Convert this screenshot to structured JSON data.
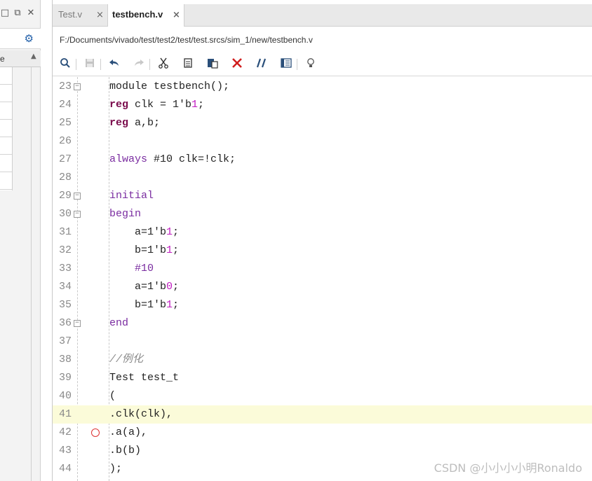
{
  "left_panel": {
    "icons": [
      "restore-icon",
      "undock-icon",
      "close-icon",
      "gear-icon"
    ],
    "column_header": "e",
    "sort_icon": "sort-up-icon"
  },
  "tabs": [
    {
      "label": "Test.v",
      "active": false,
      "close": "×"
    },
    {
      "label": "testbench.v",
      "active": true,
      "close": "×"
    }
  ],
  "path": "F:/Documents/vivado/test/test2/test/test.srcs/sim_1/new/testbench.v",
  "toolbar": [
    "search-icon",
    "save-icon",
    "undo-icon",
    "redo-icon",
    "cut-icon",
    "copy-icon",
    "paste-icon",
    "delete-icon",
    "comment-icon",
    "columns-icon",
    "lightbulb-icon"
  ],
  "code_lines": [
    {
      "n": "23",
      "fold": "−",
      "text": [
        {
          "t": "module testbench();",
          "c": ""
        }
      ]
    },
    {
      "n": "24",
      "text": [
        {
          "t": "reg",
          "c": "kw"
        },
        {
          "t": " clk = 1'b",
          "c": ""
        },
        {
          "t": "1",
          "c": "num"
        },
        {
          "t": ";",
          "c": ""
        }
      ]
    },
    {
      "n": "25",
      "text": [
        {
          "t": "reg",
          "c": "kw"
        },
        {
          "t": " a,b;",
          "c": ""
        }
      ]
    },
    {
      "n": "26",
      "text": []
    },
    {
      "n": "27",
      "text": [
        {
          "t": "always",
          "c": "kw2"
        },
        {
          "t": " #10 clk=!clk;",
          "c": ""
        }
      ]
    },
    {
      "n": "28",
      "text": []
    },
    {
      "n": "29",
      "fold": "−",
      "text": [
        {
          "t": "initial",
          "c": "kw2"
        }
      ]
    },
    {
      "n": "30",
      "fold": "−",
      "text": [
        {
          "t": "begin",
          "c": "kw2"
        }
      ]
    },
    {
      "n": "31",
      "text": [
        {
          "t": "    a=1'b",
          "c": ""
        },
        {
          "t": "1",
          "c": "num"
        },
        {
          "t": ";",
          "c": ""
        }
      ]
    },
    {
      "n": "32",
      "text": [
        {
          "t": "    b=1'b",
          "c": ""
        },
        {
          "t": "1",
          "c": "num"
        },
        {
          "t": ";",
          "c": ""
        }
      ]
    },
    {
      "n": "33",
      "text": [
        {
          "t": "    #10",
          "c": "kw2"
        }
      ]
    },
    {
      "n": "34",
      "text": [
        {
          "t": "    a=1'b",
          "c": ""
        },
        {
          "t": "0",
          "c": "num"
        },
        {
          "t": ";",
          "c": ""
        }
      ]
    },
    {
      "n": "35",
      "text": [
        {
          "t": "    b=1'b",
          "c": ""
        },
        {
          "t": "1",
          "c": "num"
        },
        {
          "t": ";",
          "c": ""
        }
      ]
    },
    {
      "n": "36",
      "fold": "−",
      "text": [
        {
          "t": "end",
          "c": "kw2"
        }
      ]
    },
    {
      "n": "37",
      "text": []
    },
    {
      "n": "38",
      "text": [
        {
          "t": "//例化",
          "c": "cmt"
        }
      ]
    },
    {
      "n": "39",
      "text": [
        {
          "t": "Test test_t",
          "c": ""
        }
      ]
    },
    {
      "n": "40",
      "text": [
        {
          "t": "(",
          "c": ""
        }
      ]
    },
    {
      "n": "41",
      "highlight": true,
      "text": [
        {
          "t": ".clk(clk),",
          "c": ""
        }
      ]
    },
    {
      "n": "42",
      "breakpoint": true,
      "text": [
        {
          "t": ".a(a),",
          "c": ""
        }
      ]
    },
    {
      "n": "43",
      "text": [
        {
          "t": ".b(b)",
          "c": ""
        }
      ]
    },
    {
      "n": "44",
      "text": [
        {
          "t": ");",
          "c": ""
        }
      ]
    }
  ],
  "watermark": "CSDN @小小小小明Ronaldo"
}
